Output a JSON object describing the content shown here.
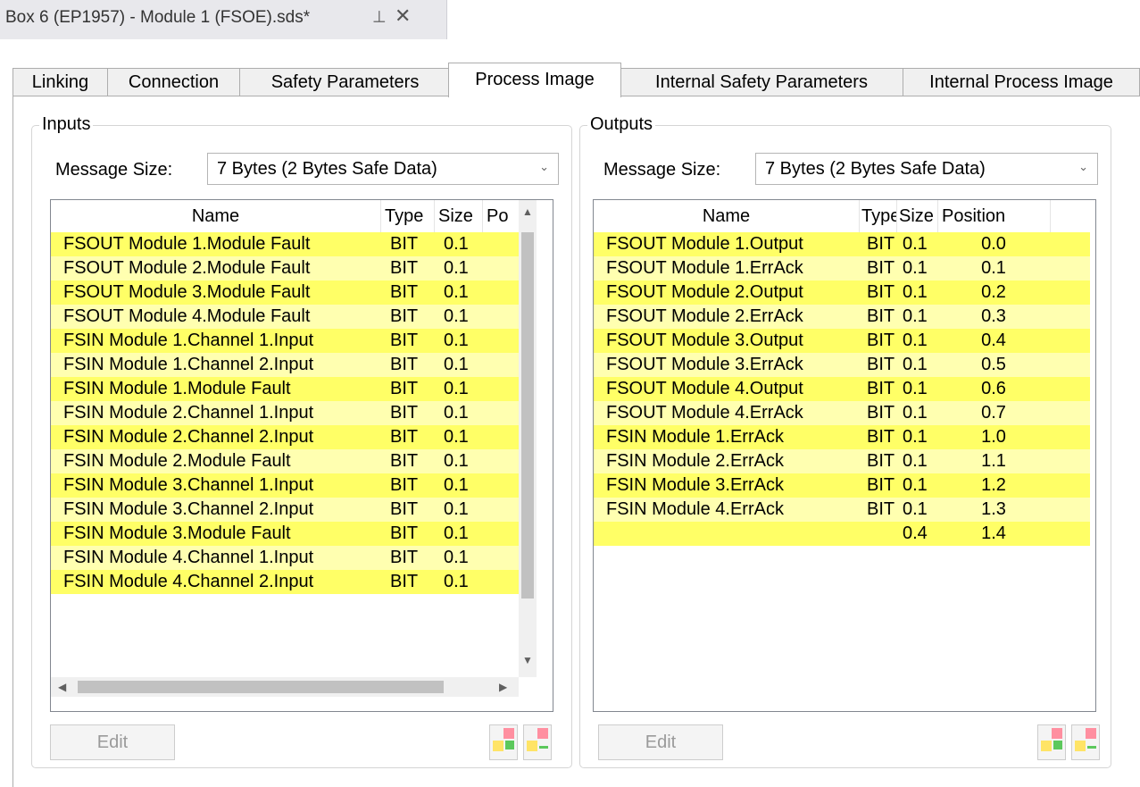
{
  "document": {
    "title": "Box 6 (EP1957) - Module 1 (FSOE).sds*",
    "pin_glyph": "⊣",
    "close_glyph": "✕"
  },
  "tabs": [
    "Linking",
    "Connection",
    "Safety Parameters",
    "Process Image",
    "Internal Safety Parameters",
    "Internal Process Image"
  ],
  "active_tab": "Process Image",
  "colors": {
    "row_dark": "#ffff66",
    "row_light": "#ffffb0"
  },
  "inputs": {
    "label": "Inputs",
    "message_size_label": "Message Size:",
    "message_size_value": "7 Bytes (2 Bytes Safe Data)",
    "columns": [
      "Name",
      "Type",
      "Size",
      "Po"
    ],
    "rows": [
      {
        "name": "FSOUT Module 1.Module Fault",
        "type": "BIT",
        "size": "0.1"
      },
      {
        "name": "FSOUT Module 2.Module Fault",
        "type": "BIT",
        "size": "0.1"
      },
      {
        "name": "FSOUT Module 3.Module Fault",
        "type": "BIT",
        "size": "0.1"
      },
      {
        "name": "FSOUT Module 4.Module Fault",
        "type": "BIT",
        "size": "0.1"
      },
      {
        "name": "FSIN Module 1.Channel 1.Input",
        "type": "BIT",
        "size": "0.1"
      },
      {
        "name": "FSIN Module 1.Channel 2.Input",
        "type": "BIT",
        "size": "0.1"
      },
      {
        "name": "FSIN Module 1.Module Fault",
        "type": "BIT",
        "size": "0.1"
      },
      {
        "name": "FSIN Module 2.Channel 1.Input",
        "type": "BIT",
        "size": "0.1"
      },
      {
        "name": "FSIN Module 2.Channel 2.Input",
        "type": "BIT",
        "size": "0.1"
      },
      {
        "name": "FSIN Module 2.Module Fault",
        "type": "BIT",
        "size": "0.1"
      },
      {
        "name": "FSIN Module 3.Channel 1.Input",
        "type": "BIT",
        "size": "0.1"
      },
      {
        "name": "FSIN Module 3.Channel 2.Input",
        "type": "BIT",
        "size": "0.1"
      },
      {
        "name": "FSIN Module 3.Module Fault",
        "type": "BIT",
        "size": "0.1"
      },
      {
        "name": "FSIN Module 4.Channel 1.Input",
        "type": "BIT",
        "size": "0.1"
      },
      {
        "name": "FSIN Module 4.Channel 2.Input",
        "type": "BIT",
        "size": "0.1"
      }
    ],
    "edit_label": "Edit"
  },
  "outputs": {
    "label": "Outputs",
    "message_size_label": "Message Size:",
    "message_size_value": "7 Bytes (2 Bytes Safe Data)",
    "columns": [
      "Name",
      "Type",
      "Size",
      "Position"
    ],
    "rows": [
      {
        "name": "FSOUT Module 1.Output",
        "type": "BIT",
        "size": "0.1",
        "position": "0.0"
      },
      {
        "name": "FSOUT Module 1.ErrAck",
        "type": "BIT",
        "size": "0.1",
        "position": "0.1"
      },
      {
        "name": "FSOUT Module 2.Output",
        "type": "BIT",
        "size": "0.1",
        "position": "0.2"
      },
      {
        "name": "FSOUT Module 2.ErrAck",
        "type": "BIT",
        "size": "0.1",
        "position": "0.3"
      },
      {
        "name": "FSOUT Module 3.Output",
        "type": "BIT",
        "size": "0.1",
        "position": "0.4"
      },
      {
        "name": "FSOUT Module 3.ErrAck",
        "type": "BIT",
        "size": "0.1",
        "position": "0.5"
      },
      {
        "name": "FSOUT Module 4.Output",
        "type": "BIT",
        "size": "0.1",
        "position": "0.6"
      },
      {
        "name": "FSOUT Module 4.ErrAck",
        "type": "BIT",
        "size": "0.1",
        "position": "0.7"
      },
      {
        "name": "FSIN Module 1.ErrAck",
        "type": "BIT",
        "size": "0.1",
        "position": "1.0"
      },
      {
        "name": "FSIN Module 2.ErrAck",
        "type": "BIT",
        "size": "0.1",
        "position": "1.1"
      },
      {
        "name": "FSIN Module 3.ErrAck",
        "type": "BIT",
        "size": "0.1",
        "position": "1.2"
      },
      {
        "name": "FSIN Module 4.ErrAck",
        "type": "BIT",
        "size": "0.1",
        "position": "1.3"
      },
      {
        "name": "",
        "type": "",
        "size": "0.4",
        "position": "1.4"
      }
    ],
    "edit_label": "Edit"
  },
  "icons": {
    "combo_arrow": "⌄",
    "scroll_up": "▲",
    "scroll_down": "▼",
    "scroll_left": "◀",
    "scroll_right": "▶"
  }
}
